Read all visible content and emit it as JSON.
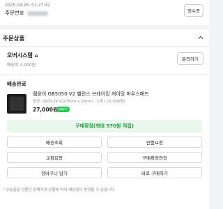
{
  "top": {
    "date": "2025.04.26. 01:27:42",
    "order_label": "주문번호",
    "receipt_button": "영수증"
  },
  "order_section": {
    "title": "주문상품"
  },
  "seller": {
    "name": "오버시스템",
    "shipping": "배송비 3,000원",
    "inquiry_button": "문의하기"
  },
  "item": {
    "status": "배송완료",
    "product_name": "켐윤이 GB5050 V2 밸런스 브레이킹 게이밍 마우스패드",
    "option": "옵션: GB3529 V2(35cm x 29cm) · 1개 (-11,000원)",
    "price": "27,000원",
    "badge": "pay+"
  },
  "actions": {
    "confirm": "구매확정(최대 570원 적립)",
    "track": "배송조회",
    "return": "반품요청",
    "exchange": "교환요청",
    "extend": "구매확정연장",
    "cart": "장바구니 담기",
    "buy_now": "바로 구매하기"
  },
  "notice": "* 오늘출발 상품은 판매자의 상황에 따라 배송일이 변경될 수 있습니다."
}
